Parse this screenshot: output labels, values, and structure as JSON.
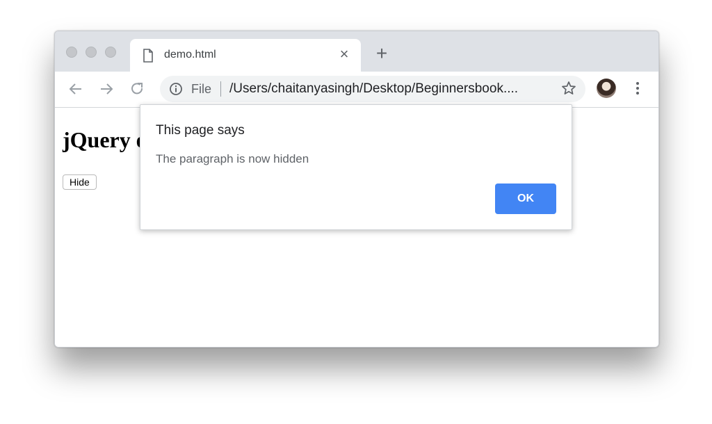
{
  "tab": {
    "title": "demo.html",
    "close_symbol": "×",
    "new_tab_symbol": "+"
  },
  "omnibox": {
    "scheme_label": "File",
    "url": "/Users/chaitanyasingh/Desktop/Beginnersbook...."
  },
  "page": {
    "heading": "jQuery",
    "heading_trailing_glyph": "e",
    "hide_button_label": "Hide"
  },
  "dialog": {
    "title": "This page says",
    "message": "The paragraph is now hidden",
    "ok_label": "OK"
  },
  "colors": {
    "titlebar": "#dee1e6",
    "omnibox_bg": "#f1f3f4",
    "ok_button": "#4285f4",
    "icon_gray": "#5f6368"
  },
  "icons": [
    "file-icon",
    "close-icon",
    "plus-icon",
    "back-arrow-icon",
    "forward-arrow-icon",
    "reload-icon",
    "info-icon",
    "star-icon",
    "avatar",
    "more-vert-icon"
  ]
}
